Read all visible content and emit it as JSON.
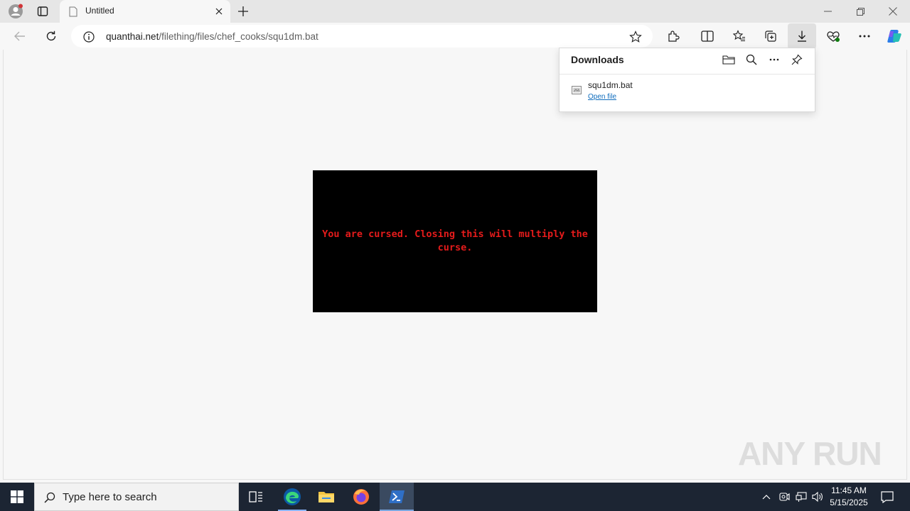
{
  "browser": {
    "tab_title": "Untitled",
    "url_domain": "quanthai.net",
    "url_path": "/filething/files/chef_cooks/squ1dm.bat"
  },
  "page": {
    "message": "You are cursed. Closing this will multiply the curse."
  },
  "downloads": {
    "title": "Downloads",
    "items": [
      {
        "filename": "squ1dm.bat",
        "action": "Open file"
      }
    ]
  },
  "watermark": "ANY RUN",
  "taskbar": {
    "search_placeholder": "Type here to search",
    "time": "11:45 AM",
    "date": "5/15/2025"
  },
  "colors": {
    "curse_text": "#e51b1b",
    "curse_bg": "#000000",
    "link": "#0f6cbd",
    "taskbar": "#1c2533"
  }
}
